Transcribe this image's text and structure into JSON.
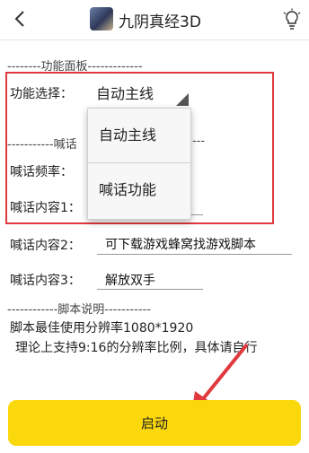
{
  "header": {
    "back_icon": "back-arrow-icon",
    "app_icon": "game-avatar-icon",
    "title": "九阴真经3D",
    "bulb_icon": "lightbulb-icon"
  },
  "function_panel": {
    "separator": "--------功能面板-------------",
    "select_label": "功能选择：",
    "select_value": "自动主线",
    "talk_separator_prefix": "-----------喊话",
    "talk_separator_suffix": "---"
  },
  "dropdown": {
    "options": [
      "自动主线",
      "喊话功能"
    ]
  },
  "fields": {
    "frequency_label": "喊话频率：",
    "content1_label": "喊话内容1：",
    "content2_label": "喊话内容2：",
    "content2_value": "可下载游戏蜂窝找游戏脚本",
    "content3_label": "喊话内容3：",
    "content3_value": "解放双手"
  },
  "script_info": {
    "separator": "------------脚本说明-----------",
    "line1": "脚本最佳使用分辨率1080*1920",
    "line2": "理论上支持9:16的分辨率比例，具体请自行"
  },
  "start_button": {
    "label": "启动"
  },
  "colors": {
    "highlight_border": "#e0393e",
    "arrow": "#e0393e",
    "start_button": "#fbd80c"
  }
}
